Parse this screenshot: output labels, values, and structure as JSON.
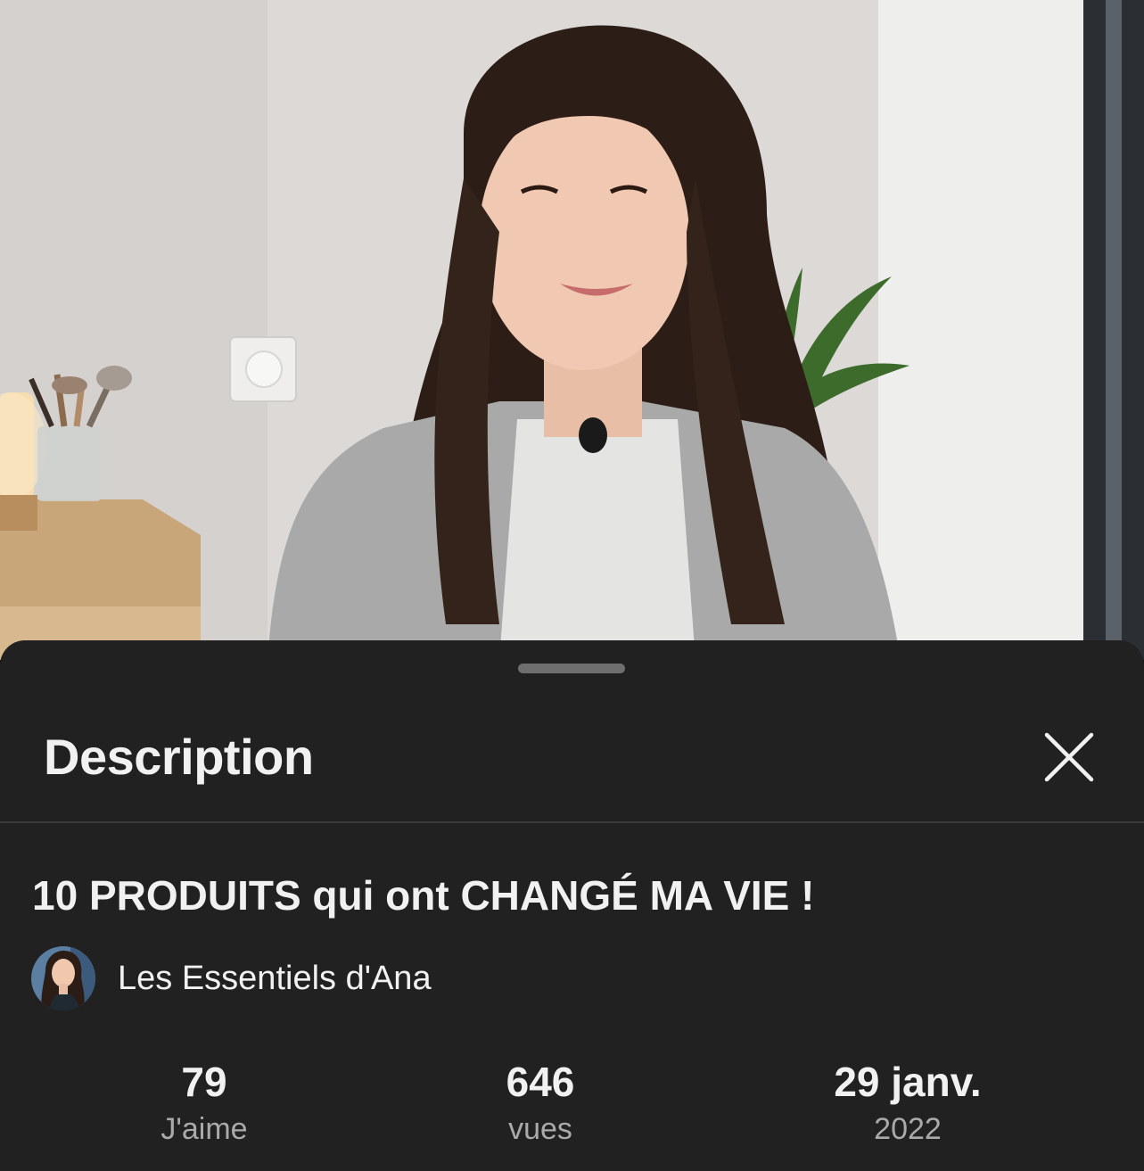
{
  "video": {
    "thumbnail_icon": "video-frame-woman-smiling"
  },
  "sheet": {
    "title": "Description",
    "close_icon": "close-icon"
  },
  "video_info": {
    "title": "10 PRODUITS qui ont CHANGÉ MA VIE !",
    "channel_name": "Les Essentiels d'Ana",
    "channel_avatar_icon": "avatar"
  },
  "stats": [
    {
      "value": "79",
      "label": "J'aime"
    },
    {
      "value": "646",
      "label": "vues"
    },
    {
      "value": "29 janv.",
      "label": "2022"
    }
  ],
  "colors": {
    "sheet_background": "#212121",
    "primary_text": "#f1f1f1",
    "secondary_text": "#aaaaaa",
    "divider": "#3a3a3a",
    "handle": "#6f6f6f"
  }
}
